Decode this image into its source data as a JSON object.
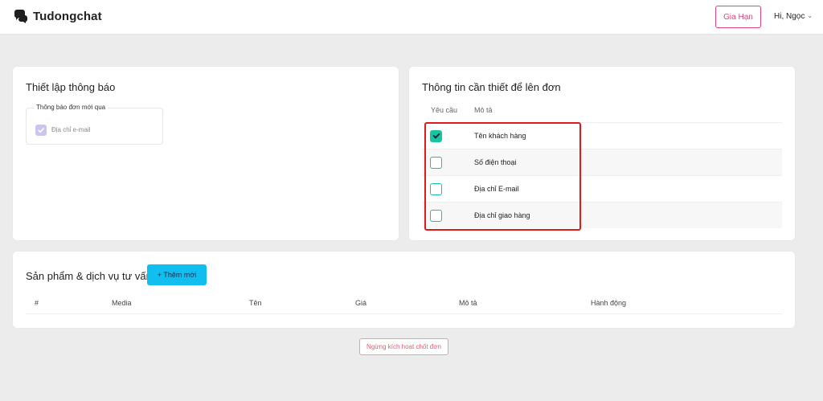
{
  "header": {
    "brand": "Tudongchat",
    "renew_label": "Gia Hạn",
    "user_greeting": "Hi, Ngọc",
    "logo_icon": "chat-bubbles-icon",
    "user_chevron_icon": "chevron-down-icon"
  },
  "notification_card": {
    "title": "Thiết lập thông báo",
    "group_label": "Thông báo đơn mới qua",
    "options": [
      {
        "label": "Địa chỉ e-mail",
        "checked": true,
        "disabled": true
      }
    ]
  },
  "order_info_card": {
    "title": "Thông tin cần thiết để lên đơn",
    "columns": [
      "Yêu cầu",
      "Mô tả"
    ],
    "rows": [
      {
        "label": "Tên khách hàng",
        "required": true
      },
      {
        "label": "Số điện thoại",
        "required": false
      },
      {
        "label": "Địa chỉ E-mail",
        "required": false
      },
      {
        "label": "Địa chỉ giao hàng",
        "required": false
      }
    ]
  },
  "products_card": {
    "title": "Sản phẩm & dịch vụ tư vấn",
    "add_label": "+ Thêm mới",
    "columns": [
      "#",
      "Media",
      "Tên",
      "Giá",
      "Mô tả",
      "Hành động"
    ]
  },
  "deactivate_label": "Ngừng kích hoạt chốt đơn",
  "colors": {
    "accent_pink": "#e8407c",
    "checkbox_teal": "#19c4a0",
    "add_button_blue": "#10bef0",
    "highlight_red": "#e01919",
    "disabled_checkbox": "#c9c5f0"
  }
}
